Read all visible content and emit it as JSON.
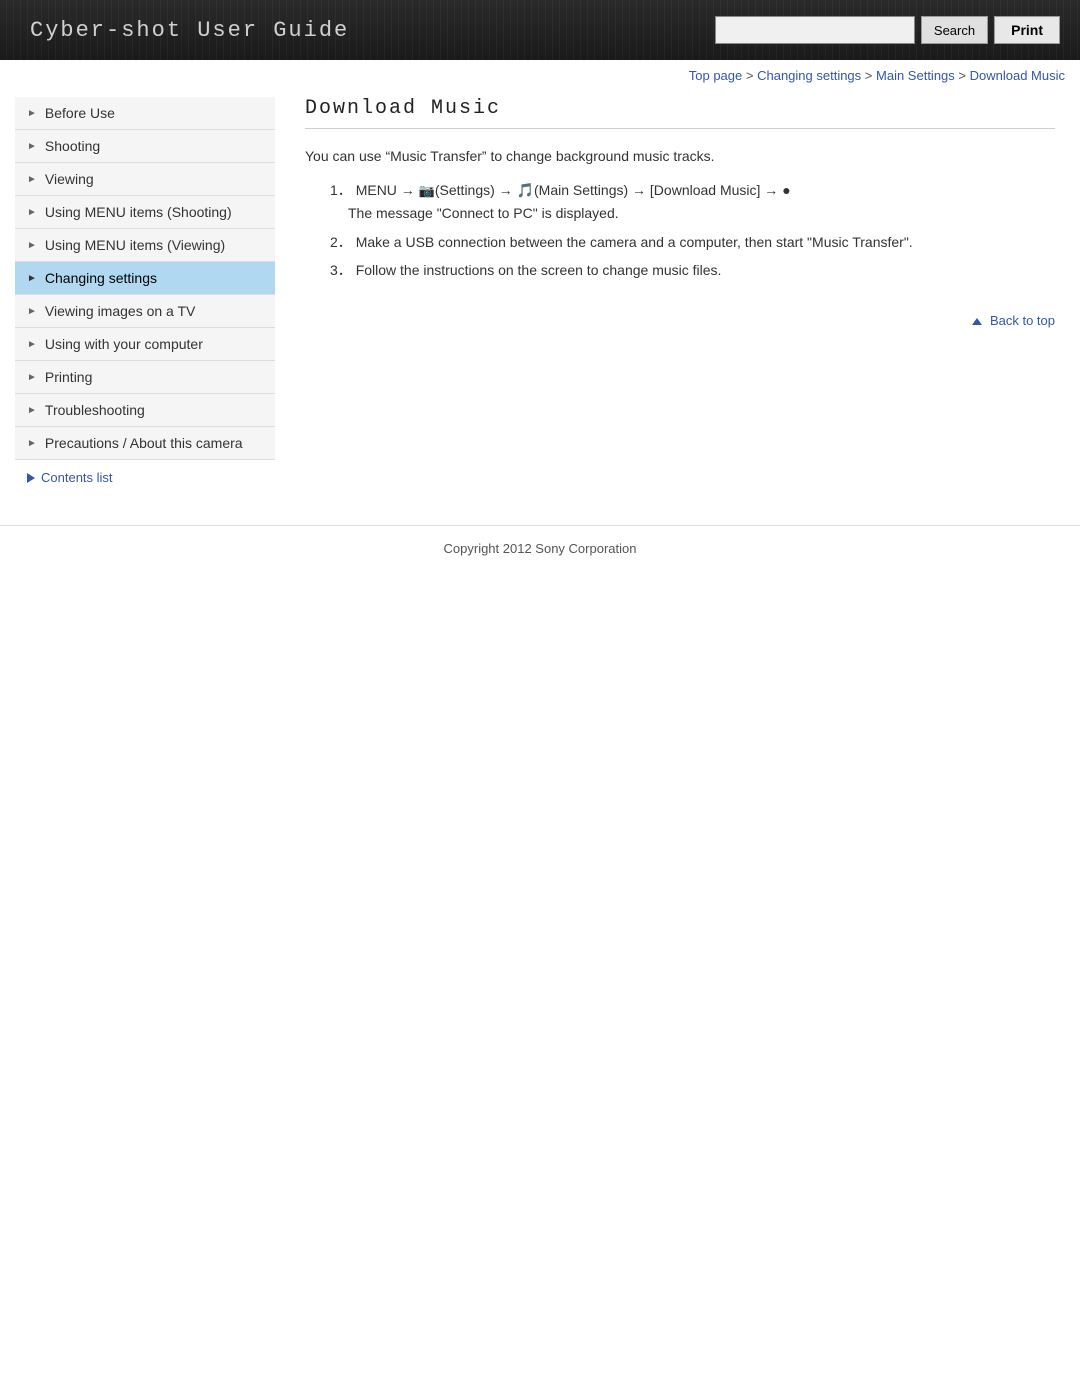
{
  "header": {
    "title": "Cyber-shot User Guide",
    "search_placeholder": "",
    "search_button": "Search",
    "print_button": "Print"
  },
  "breadcrumb": {
    "items": [
      {
        "label": "Top page",
        "href": "#"
      },
      {
        "label": "Changing settings",
        "href": "#"
      },
      {
        "label": "Main Settings",
        "href": "#"
      },
      {
        "label": "Download Music",
        "href": "#"
      }
    ],
    "separator": " > "
  },
  "sidebar": {
    "items": [
      {
        "label": "Before Use",
        "active": false
      },
      {
        "label": "Shooting",
        "active": false
      },
      {
        "label": "Viewing",
        "active": false
      },
      {
        "label": "Using MENU items (Shooting)",
        "active": false
      },
      {
        "label": "Using MENU items (Viewing)",
        "active": false
      },
      {
        "label": "Changing settings",
        "active": true
      },
      {
        "label": "Viewing images on a TV",
        "active": false
      },
      {
        "label": "Using with your computer",
        "active": false
      },
      {
        "label": "Printing",
        "active": false
      },
      {
        "label": "Troubleshooting",
        "active": false
      },
      {
        "label": "Precautions / About this camera",
        "active": false
      }
    ],
    "contents_link": "Contents list"
  },
  "content": {
    "title": "Download Music",
    "intro": "You can use “Music Transfer” to change background music tracks.",
    "steps": [
      {
        "number": "1",
        "text": "MENU → 🖳(Settings) → 🎵(Main Settings) → [Download Music] → ●",
        "sub": "The message “Connect to PC” is displayed."
      },
      {
        "number": "2",
        "text": "Make a USB connection between the camera and a computer, then start “Music Transfer”."
      },
      {
        "number": "3",
        "text": "Follow the instructions on the screen to change music files."
      }
    ],
    "back_to_top": "Back to top"
  },
  "footer": {
    "copyright": "Copyright 2012 Sony Corporation"
  }
}
